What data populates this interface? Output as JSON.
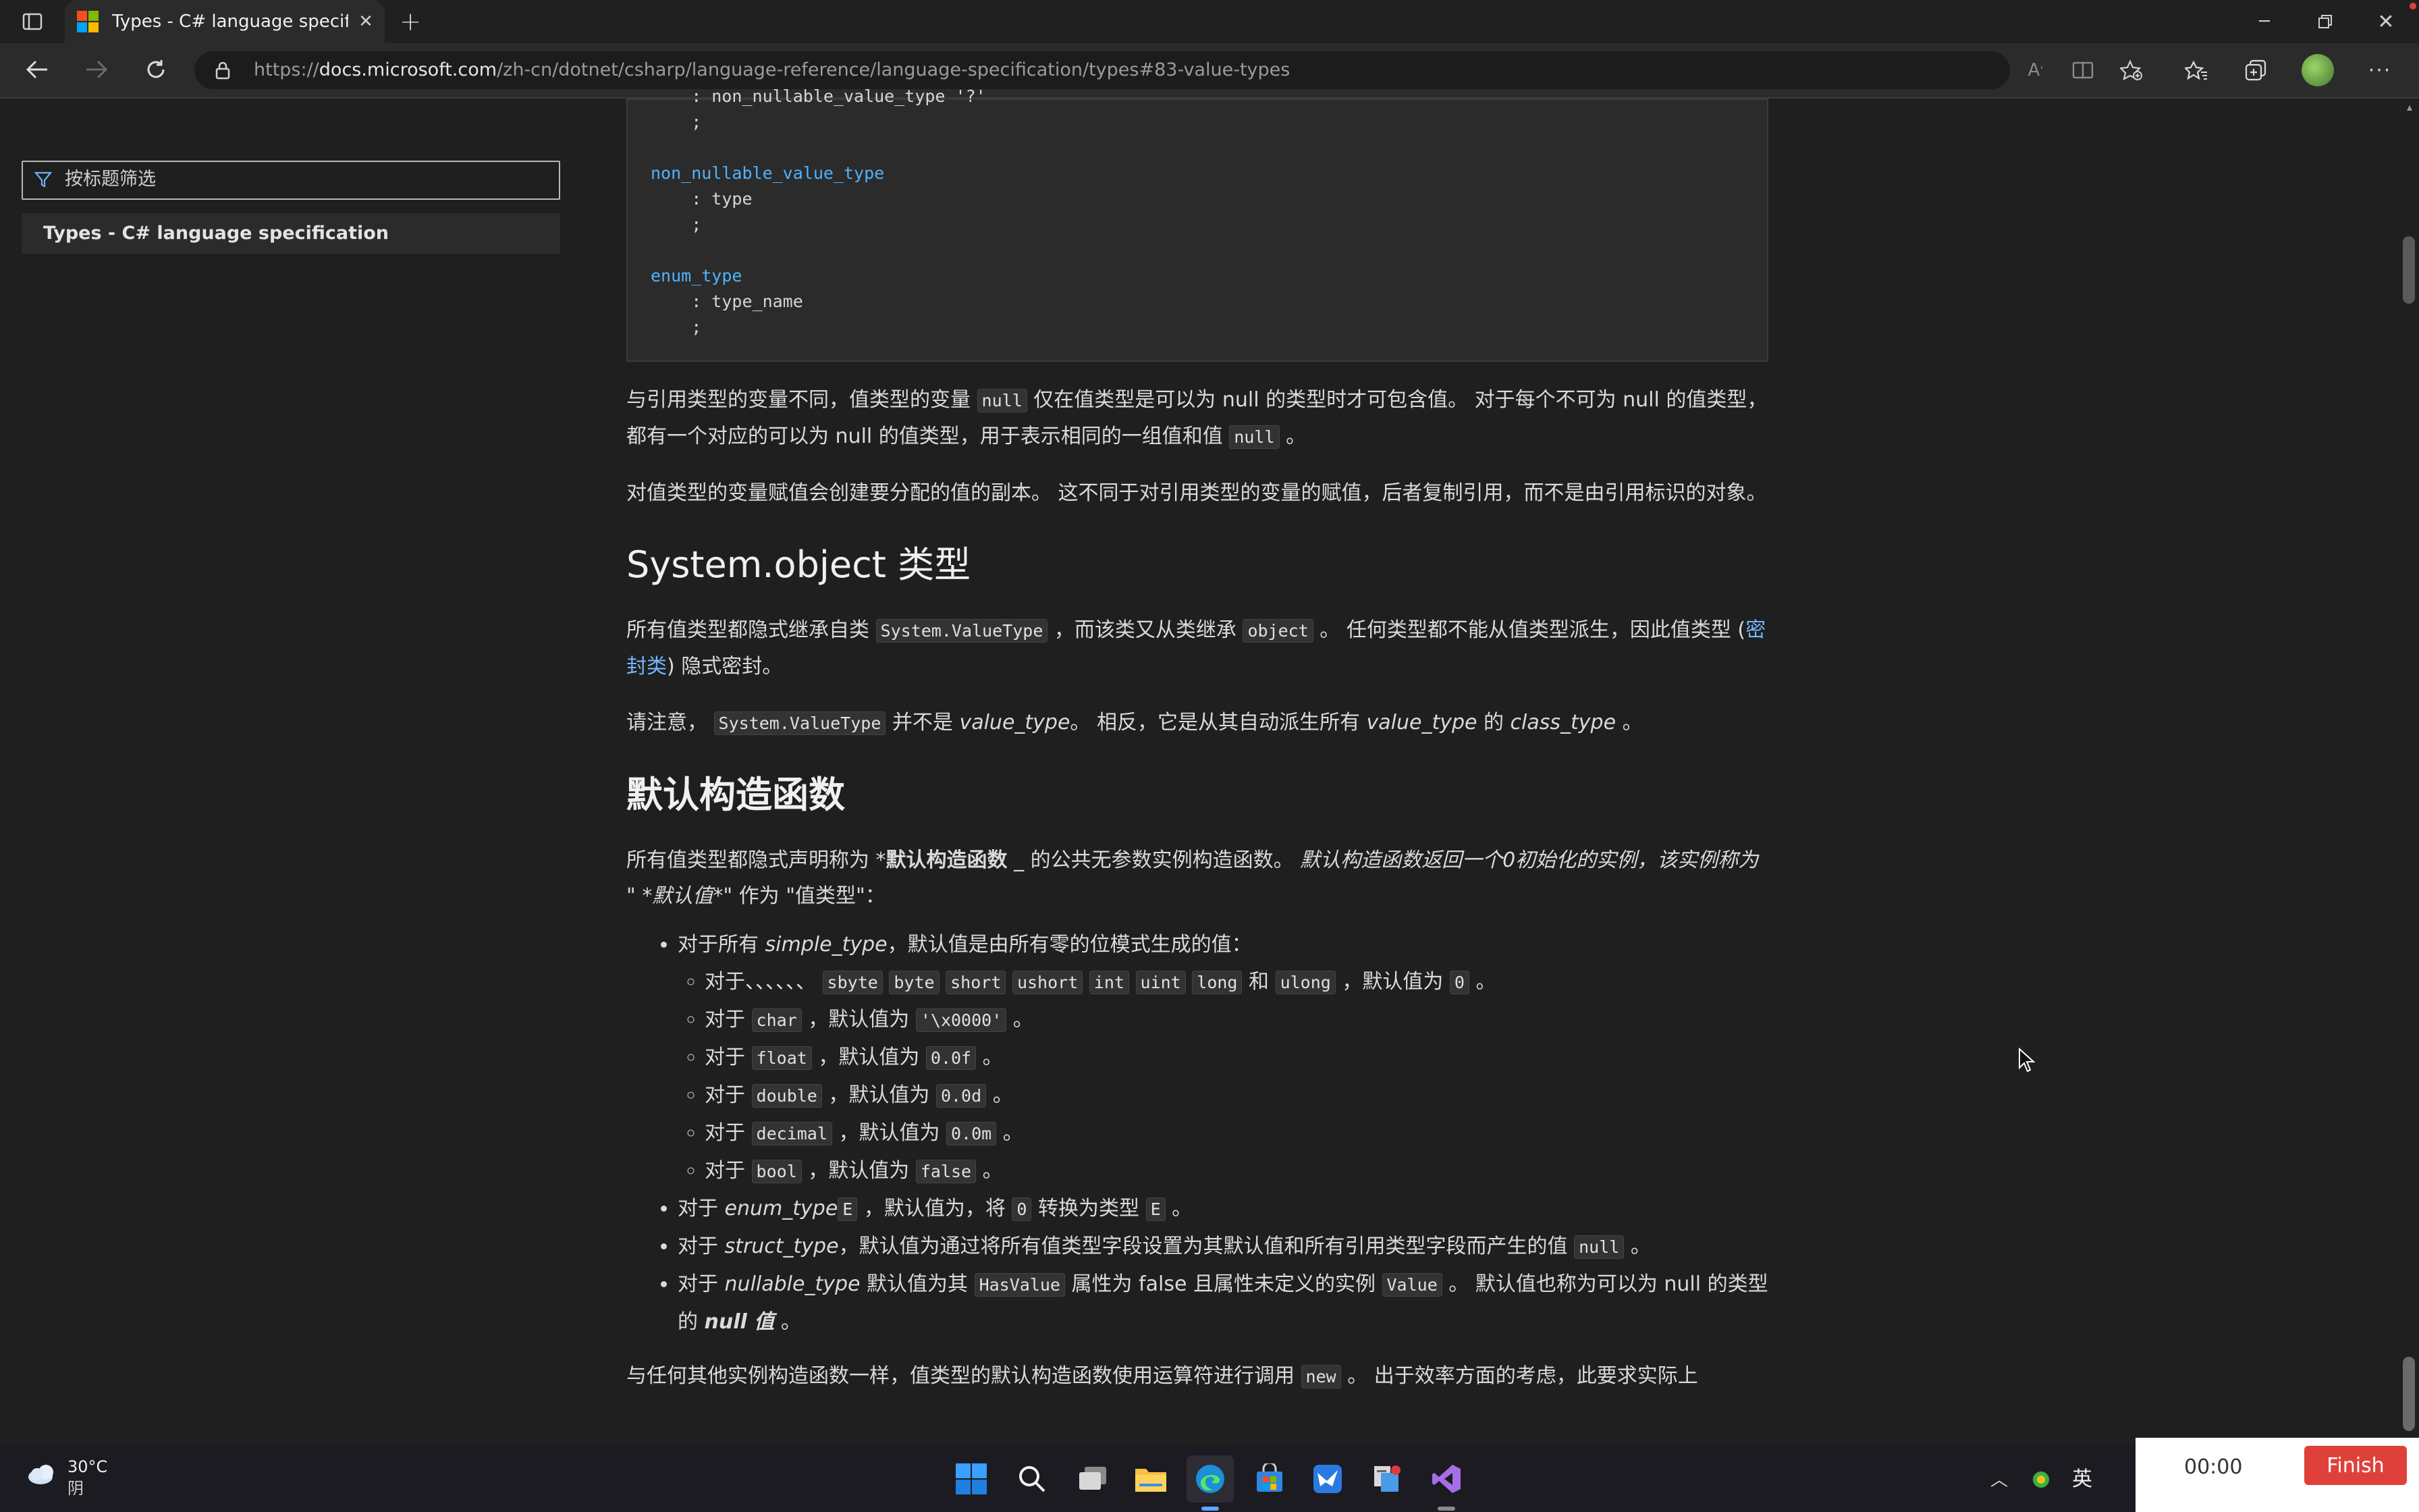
{
  "browser": {
    "tab_title": "Types - C# language specificatio",
    "url_prefix": "https://",
    "url_host": "docs.microsoft.com",
    "url_path": "/zh-cn/dotnet/csharp/language-reference/language-specification/types#83-value-types"
  },
  "sidebar": {
    "filter_placeholder": "按标题筛选",
    "toc_item": "Types - C# language specification"
  },
  "code_block": {
    "line1": "    : non_nullable_value_type '?'",
    "line2": "    ;",
    "rule2_name": "non_nullable_value_type",
    "rule2_line1": "    : type",
    "rule2_line2": "    ;",
    "rule3_name": "enum_type",
    "rule3_line1": "    : type_name",
    "rule3_line2": "    ;"
  },
  "article": {
    "p1_a": "与引用类型的变量不同，值类型的变量 ",
    "p1_code1": "null",
    "p1_b": " 仅在值类型是可以为 null 的类型时才可包含值。 对于每个不可为 null 的值类型，都有一个对应的可以为 null 的值类型，用于表示相同的一组值和值 ",
    "p1_code2": "null",
    "p1_c": " 。",
    "p2": "对值类型的变量赋值会创建要分配的值的副本。 这不同于对引用类型的变量的赋值，后者复制引用，而不是由引用标识的对象。",
    "h_object": "System.object 类型",
    "p3_a": "所有值类型都隐式继承自类 ",
    "p3_code1": "System.ValueType",
    "p3_b": " ，而该类又从类继承 ",
    "p3_code2": "object",
    "p3_c": " 。 任何类型都不能从值类型派生，因此值类型 (",
    "p3_link": "密封类",
    "p3_d": ") 隐式密封。",
    "p4_a": "请注意， ",
    "p4_code": "System.ValueType",
    "p4_b": " 并不是 ",
    "p4_i1": "value_type",
    "p4_c": "。 相反，它是从其自动派生所有 ",
    "p4_i2": "value_type",
    "p4_d": " 的 ",
    "p4_i3": "class_type",
    "p4_e": " 。",
    "h_ctor": "默认构造函数",
    "p5_a": "所有值类型都隐式声明称为 *",
    "p5_b": "默认构造函数",
    "p5_c": " _ 的公共无参数实例构造函数。 ",
    "p5_d": "默认构造函数返回一个0初始化的实例，该实例称为 \" *默认值",
    "p5_e": "*\" 作为 \"值类型\"：",
    "li1_a": "对于所有 ",
    "li1_i": "simple_type",
    "li1_b": "，默认值是由所有零的位模式生成的值：",
    "sub1_a": "对于、、、、、、 ",
    "sub1_codes": [
      "sbyte",
      "byte",
      "short",
      "ushort",
      "int",
      "uint",
      "long"
    ],
    "sub1_and": " 和 ",
    "sub1_code_last": "ulong",
    "sub1_b": " ，默认值为 ",
    "sub1_zero": "0",
    "sub1_c": " 。",
    "sub_prefix": "对于 ",
    "sub_mid": " ，默认值为 ",
    "sub_end": " 。",
    "sub_items": [
      {
        "type": "char",
        "value": "'\\x0000'"
      },
      {
        "type": "float",
        "value": "0.0f"
      },
      {
        "type": "double",
        "value": "0.0d"
      },
      {
        "type": "decimal",
        "value": "0.0m"
      },
      {
        "type": "bool",
        "value": "false"
      }
    ],
    "li2_a": "对于 ",
    "li2_i": "enum_type",
    "li2_code1": "E",
    "li2_b": " ，默认值为，将 ",
    "li2_code2": "0",
    "li2_c": " 转换为类型 ",
    "li2_code3": "E",
    "li2_d": " 。",
    "li3_a": "对于 ",
    "li3_i": "struct_type",
    "li3_b": "，默认值为通过将所有值类型字段设置为其默认值和所有引用类型字段而产生的值 ",
    "li3_code": "null",
    "li3_c": " 。",
    "li4_a": "对于 ",
    "li4_i": "nullable_type",
    "li4_b": " 默认值为其 ",
    "li4_code1": "HasValue",
    "li4_c": " 属性为 false 且属性未定义的实例 ",
    "li4_code2": "Value",
    "li4_d": " 。 默认值也称为可以为 null 的类型的 ",
    "li4_bi": "null 值",
    "li4_e": " 。",
    "p6_a": "与任何其他实例构造函数一样，值类型的默认构造函数使用运算符进行调用 ",
    "p6_code": "new",
    "p6_b": " 。 出于效率方面的考虑，此要求实际上"
  },
  "taskbar": {
    "temperature": "30°C",
    "weather": "阴",
    "ime": "英"
  },
  "timer": {
    "time": "00:00",
    "finish_label": "Finish"
  },
  "colors": {
    "accent_link": "#75b6ff",
    "code_keyword": "#4fb3ff",
    "finish_button": "#e0403a"
  }
}
